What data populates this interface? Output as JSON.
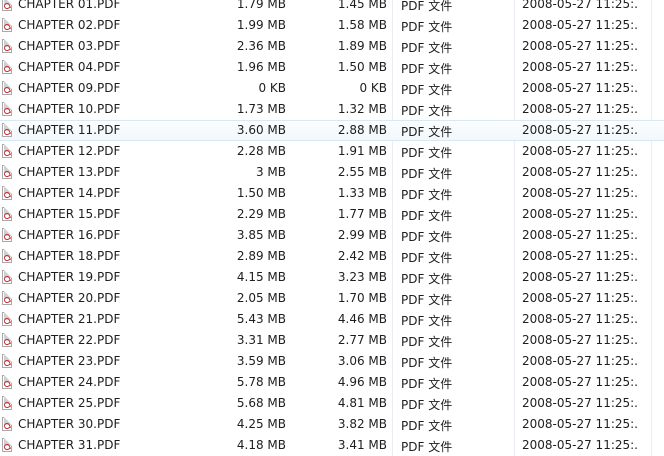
{
  "files": [
    {
      "name": "CHAPTER 01.PDF",
      "size": "1.79 MB",
      "packed": "1.45 MB",
      "type": "PDF 文件",
      "modified": "2008-05-27 11:25:..."
    },
    {
      "name": "CHAPTER 02.PDF",
      "size": "1.99 MB",
      "packed": "1.58 MB",
      "type": "PDF 文件",
      "modified": "2008-05-27 11:25:..."
    },
    {
      "name": "CHAPTER 03.PDF",
      "size": "2.36 MB",
      "packed": "1.89 MB",
      "type": "PDF 文件",
      "modified": "2008-05-27 11:25:..."
    },
    {
      "name": "CHAPTER 04.PDF",
      "size": "1.96 MB",
      "packed": "1.50 MB",
      "type": "PDF 文件",
      "modified": "2008-05-27 11:25:..."
    },
    {
      "name": "CHAPTER 09.PDF",
      "size": "0 KB",
      "packed": "0 KB",
      "type": "PDF 文件",
      "modified": "2008-05-27 11:25:..."
    },
    {
      "name": "CHAPTER 10.PDF",
      "size": "1.73 MB",
      "packed": "1.32 MB",
      "type": "PDF 文件",
      "modified": "2008-05-27 11:25:..."
    },
    {
      "name": "CHAPTER 11.PDF",
      "size": "3.60 MB",
      "packed": "2.88 MB",
      "type": "PDF 文件",
      "modified": "2008-05-27 11:25:...",
      "hover": true
    },
    {
      "name": "CHAPTER 12.PDF",
      "size": "2.28 MB",
      "packed": "1.91 MB",
      "type": "PDF 文件",
      "modified": "2008-05-27 11:25:..."
    },
    {
      "name": "CHAPTER 13.PDF",
      "size": "3 MB",
      "packed": "2.55 MB",
      "type": "PDF 文件",
      "modified": "2008-05-27 11:25:..."
    },
    {
      "name": "CHAPTER 14.PDF",
      "size": "1.50 MB",
      "packed": "1.33 MB",
      "type": "PDF 文件",
      "modified": "2008-05-27 11:25:..."
    },
    {
      "name": "CHAPTER 15.PDF",
      "size": "2.29 MB",
      "packed": "1.77 MB",
      "type": "PDF 文件",
      "modified": "2008-05-27 11:25:..."
    },
    {
      "name": "CHAPTER 16.PDF",
      "size": "3.85 MB",
      "packed": "2.99 MB",
      "type": "PDF 文件",
      "modified": "2008-05-27 11:25:..."
    },
    {
      "name": "CHAPTER 18.PDF",
      "size": "2.89 MB",
      "packed": "2.42 MB",
      "type": "PDF 文件",
      "modified": "2008-05-27 11:25:..."
    },
    {
      "name": "CHAPTER 19.PDF",
      "size": "4.15 MB",
      "packed": "3.23 MB",
      "type": "PDF 文件",
      "modified": "2008-05-27 11:25:..."
    },
    {
      "name": "CHAPTER 20.PDF",
      "size": "2.05 MB",
      "packed": "1.70 MB",
      "type": "PDF 文件",
      "modified": "2008-05-27 11:25:..."
    },
    {
      "name": "CHAPTER 21.PDF",
      "size": "5.43 MB",
      "packed": "4.46 MB",
      "type": "PDF 文件",
      "modified": "2008-05-27 11:25:..."
    },
    {
      "name": "CHAPTER 22.PDF",
      "size": "3.31 MB",
      "packed": "2.77 MB",
      "type": "PDF 文件",
      "modified": "2008-05-27 11:25:..."
    },
    {
      "name": "CHAPTER 23.PDF",
      "size": "3.59 MB",
      "packed": "3.06 MB",
      "type": "PDF 文件",
      "modified": "2008-05-27 11:25:..."
    },
    {
      "name": "CHAPTER 24.PDF",
      "size": "5.78 MB",
      "packed": "4.96 MB",
      "type": "PDF 文件",
      "modified": "2008-05-27 11:25:..."
    },
    {
      "name": "CHAPTER 25.PDF",
      "size": "5.68 MB",
      "packed": "4.81 MB",
      "type": "PDF 文件",
      "modified": "2008-05-27 11:25:..."
    },
    {
      "name": "CHAPTER 30.PDF",
      "size": "4.25 MB",
      "packed": "3.82 MB",
      "type": "PDF 文件",
      "modified": "2008-05-27 11:25:..."
    },
    {
      "name": "CHAPTER 31.PDF",
      "size": "4.18 MB",
      "packed": "3.41 MB",
      "type": "PDF 文件",
      "modified": "2008-05-27 11:25:..."
    }
  ],
  "file_icon": "pdf-file-icon",
  "colors": {
    "hover_border": "#d8e8f5",
    "column_separator": "#eaeef2",
    "pdf_icon_accent": "#c4272d"
  }
}
